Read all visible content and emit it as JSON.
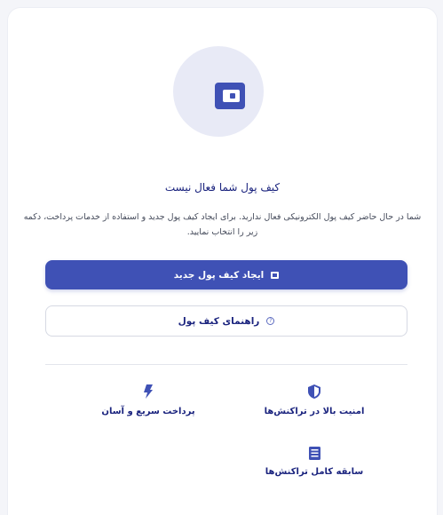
{
  "empty_state": {
    "title": "کیف پول شما فعال نیست",
    "description": "شما در حال حاضر کیف پول الکترونیکی فعال ندارید. برای ایجاد کیف پول جدید و استفاده از خدمات پرداخت، دکمه زیر را انتخاب نمایید.",
    "icon": "wallet-icon"
  },
  "actions": {
    "create_label": "ایجاد کیف پول جدید",
    "create_icon": "wallet-icon",
    "guide_label": "راهنمای کیف پول",
    "guide_icon": "help-circle-icon"
  },
  "features": [
    {
      "label": "امنیت بالا در تراکنش‌ها",
      "icon": "shield-icon"
    },
    {
      "label": "پرداخت سریع و آسان",
      "icon": "lightning-icon"
    },
    {
      "label": "سابقه کامل تراکنش‌ها",
      "icon": "list-icon"
    }
  ],
  "colors": {
    "primary": "#3f51b5",
    "title": "#1a237e",
    "circle_bg": "#e8eaf6"
  }
}
